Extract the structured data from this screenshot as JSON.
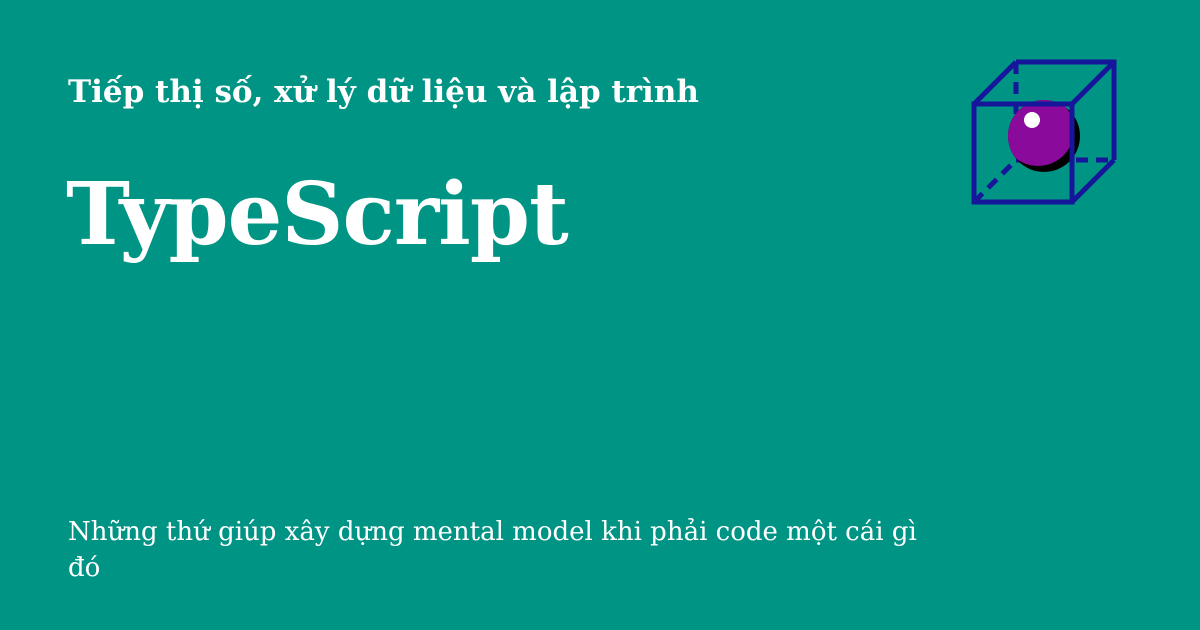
{
  "site": {
    "name": "Tiếp thị số, xử lý dữ liệu và lập trình"
  },
  "post": {
    "title": "TypeScript",
    "description": "Những thứ giúp xây dựng mental model khi phải code một cái gì đó"
  },
  "logo": {
    "icon": "cube-sphere-icon"
  },
  "colors": {
    "background": "#009485",
    "text": "#ffffff",
    "cube": "#16169a",
    "sphere": "#8a0a9c"
  }
}
